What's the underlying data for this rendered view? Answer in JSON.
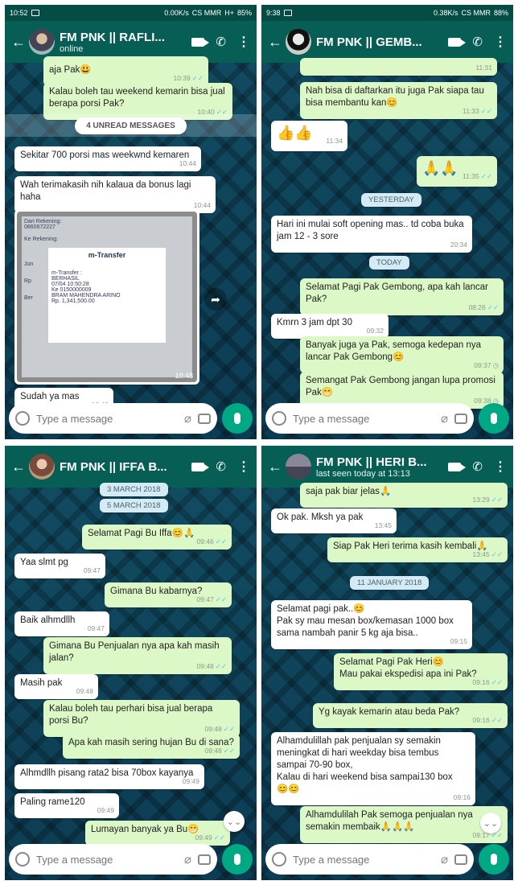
{
  "panels": [
    {
      "status": {
        "time": "10:52",
        "speed": "0.00K/s",
        "carrier": "CS MMR",
        "net": "H+",
        "battery": "85%"
      },
      "title": "FM PNK || RAFLI...",
      "subtitle": "online",
      "placeholder": "Type a message",
      "unread": "4 UNREAD MESSAGES",
      "msgs": [
        {
          "text": "aja Pak😃",
          "time": "10:39"
        },
        {
          "text": "Kalau boleh tau weekend kemarin bisa jual berapa porsi Pak?",
          "time": "10:40"
        },
        {
          "text": "Sekitar 700 porsi mas weekwnd kemaren",
          "time": "10:44"
        },
        {
          "text": "Wah terimakasih nih kalaua da bonus lagi haha",
          "time": "10:44"
        },
        {
          "text": "Sudah ya mas",
          "time": "10:48"
        }
      ],
      "image": {
        "time": "10:48",
        "from_label": "Dari Rekening:",
        "from_no": "0860672227",
        "to_label": "Ke Rekening:",
        "dialog_title": "m-Transfer",
        "d1": "m-Transfer :",
        "d2": "BERHASIL",
        "d3": "07/04 10:50:28",
        "d4": "Ke 0150000009",
        "d5": "BRAM MAHENDRA ARINO",
        "d6": "Rp. 1,341,500.00",
        "l1": "Jun",
        "l2": "Rp",
        "l3": "Ber"
      }
    },
    {
      "status": {
        "time": "9:38",
        "speed": "0.38K/s",
        "carrier": "CS MMR",
        "net": "",
        "battery": "88%"
      },
      "title": "FM PNK || GEMB...",
      "subtitle": "",
      "placeholder": "Type a message",
      "msgs": [
        {
          "text": "",
          "time": "11:31"
        },
        {
          "text": "Nah bisa di daftarkan itu juga Pak siapa tau bisa membantu kan😊",
          "time": "11:33"
        },
        {
          "text": "👍👍",
          "time": "11:34"
        },
        {
          "text": "🙏🙏",
          "time": "11:35"
        },
        {
          "text": "Hari ini mulai soft opening mas.. td coba buka jam 12 - 3 sore",
          "time": "20:34"
        },
        {
          "text": "Selamat Pagi Pak Gembong, apa kah lancar Pak?",
          "time": "08:26"
        },
        {
          "text": "Kmrn 3 jam dpt 30",
          "time": "09:32"
        },
        {
          "text": "Banyak juga ya Pak, semoga kedepan nya lancar Pak Gembong😊",
          "time": "09:37"
        },
        {
          "text": "Semangat Pak Gembong jangan lupa promosi Pak😁",
          "time": "09:38"
        }
      ],
      "chips": [
        "YESTERDAY",
        "TODAY"
      ]
    },
    {
      "title": "FM PNK || IFFA B...",
      "placeholder": "Type a message",
      "chips": [
        "3 MARCH 2018",
        "5 MARCH 2018"
      ],
      "msgs": [
        {
          "text": "Selamat Pagi Bu Iffa😊🙏",
          "time": "09:46"
        },
        {
          "text": "Yaa slmt pg",
          "time": "09:47"
        },
        {
          "text": "Gimana Bu kabarnya?",
          "time": "09:47"
        },
        {
          "text": "Baik alhmdllh",
          "time": "09:47"
        },
        {
          "text": "Gimana Bu Penjualan nya apa kah masih jalan?",
          "time": "09:48"
        },
        {
          "text": "Masih pak",
          "time": "09:48"
        },
        {
          "text": "Kalau boleh tau perhari bisa jual berapa porsi Bu?",
          "time": "09:48"
        },
        {
          "text": "Apa kah masih sering hujan Bu di sana?",
          "time": "09:48"
        },
        {
          "text": "Alhmdllh pisang rata2 bisa 70box kayanya",
          "time": "09:49"
        },
        {
          "text": "Paling rame120",
          "time": "09:49"
        },
        {
          "text": "Lumayan banyak ya Bu😁",
          "time": "09:49"
        }
      ]
    },
    {
      "title": "FM PNK || HERI B...",
      "subtitle": "last seen today at 13:13",
      "placeholder": "Type a message",
      "chips": [
        "11 JANUARY 2018"
      ],
      "msgs": [
        {
          "text": "saja pak biar jelas🙏",
          "time": "13:29"
        },
        {
          "text": "Ok pak. Mksh ya pak",
          "time": "13:45"
        },
        {
          "text": "Siap Pak Heri terima kasih kembali🙏",
          "time": "13:45"
        },
        {
          "text": "Selamat pagi pak..😊\nPak sy mau mesan box/kemasan 1000 box sama nambah panir 5 kg aja bisa..",
          "time": "09:15"
        },
        {
          "text": "Selamat Pagi Pak Heri😊\nMau pakai ekspedisi apa ini Pak?",
          "time": "09:16"
        },
        {
          "text": "Yg kayak kemarin atau beda Pak?",
          "time": "09:16"
        },
        {
          "text": "Alhamdulillah pak penjualan sy semakin meningkat di hari weekday bisa tembus sampai 70-90 box,\nKalau di hari weekend bisa sampai130 box\n😊😊",
          "time": "09:16"
        },
        {
          "text": "Alhamdulilah Pak semoga penjualan nya semakin membaik🙏🙏🙏",
          "time": "09:17"
        }
      ]
    }
  ]
}
